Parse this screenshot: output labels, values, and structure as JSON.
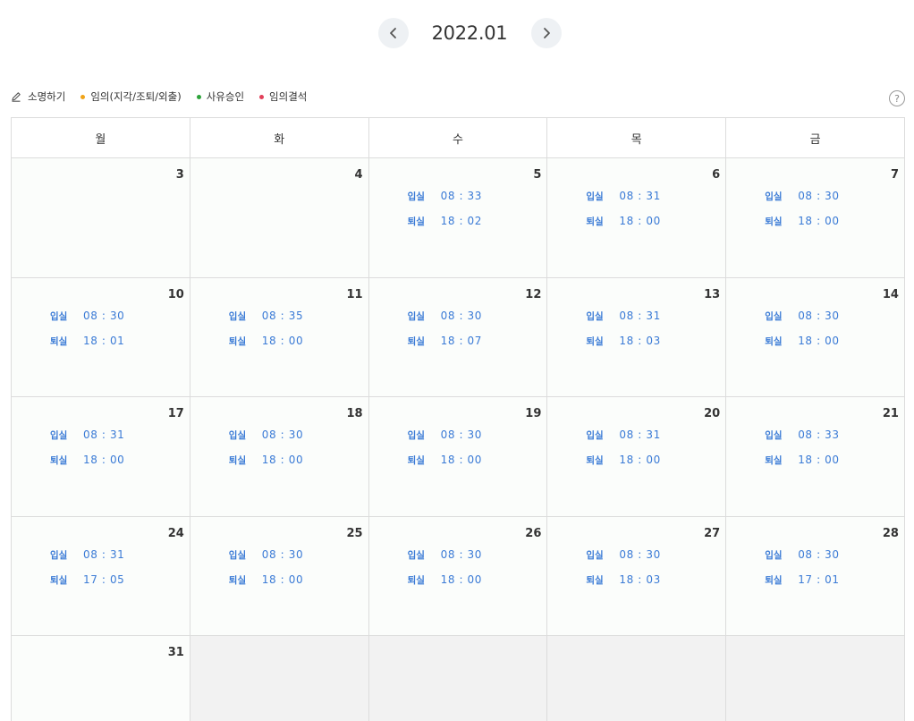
{
  "header": {
    "month": "2022.01"
  },
  "legend": {
    "write": "소명하기",
    "items": [
      {
        "label": "임의(지각/조퇴/외출)",
        "color": "#f0a318"
      },
      {
        "label": "사유승인",
        "color": "#2da33a"
      },
      {
        "label": "임의결석",
        "color": "#e2405a"
      }
    ],
    "help": "?"
  },
  "labels": {
    "in": "입실",
    "out": "퇴실"
  },
  "weekdays": [
    "월",
    "화",
    "수",
    "목",
    "금"
  ],
  "weeks": [
    [
      {
        "day": "3"
      },
      {
        "day": "4"
      },
      {
        "day": "5",
        "in": "08 : 33",
        "out": "18 : 02"
      },
      {
        "day": "6",
        "in": "08 : 31",
        "out": "18 : 00"
      },
      {
        "day": "7",
        "in": "08 : 30",
        "out": "18 : 00"
      }
    ],
    [
      {
        "day": "10",
        "in": "08 : 30",
        "out": "18 : 01"
      },
      {
        "day": "11",
        "in": "08 : 35",
        "out": "18 : 00"
      },
      {
        "day": "12",
        "in": "08 : 30",
        "out": "18 : 07"
      },
      {
        "day": "13",
        "in": "08 : 31",
        "out": "18 : 03"
      },
      {
        "day": "14",
        "in": "08 : 30",
        "out": "18 : 00"
      }
    ],
    [
      {
        "day": "17",
        "in": "08 : 31",
        "out": "18 : 00"
      },
      {
        "day": "18",
        "in": "08 : 30",
        "out": "18 : 00"
      },
      {
        "day": "19",
        "in": "08 : 30",
        "out": "18 : 00"
      },
      {
        "day": "20",
        "in": "08 : 31",
        "out": "18 : 00"
      },
      {
        "day": "21",
        "in": "08 : 33",
        "out": "18 : 00"
      }
    ],
    [
      {
        "day": "24",
        "in": "08 : 31",
        "out": "17 : 05"
      },
      {
        "day": "25",
        "in": "08 : 30",
        "out": "18 : 00"
      },
      {
        "day": "26",
        "in": "08 : 30",
        "out": "18 : 00"
      },
      {
        "day": "27",
        "in": "08 : 30",
        "out": "18 : 03"
      },
      {
        "day": "28",
        "in": "08 : 30",
        "out": "17 : 01"
      }
    ],
    [
      {
        "day": "31"
      },
      {},
      {},
      {},
      {}
    ]
  ]
}
